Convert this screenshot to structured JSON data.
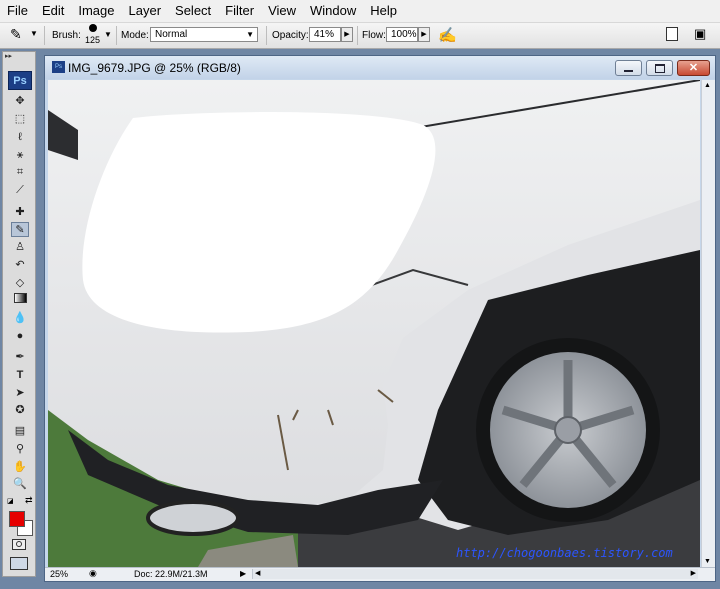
{
  "menu": [
    "File",
    "Edit",
    "Image",
    "Layer",
    "Select",
    "Filter",
    "View",
    "Window",
    "Help"
  ],
  "options": {
    "brush_label": "Brush:",
    "brush_size": "125",
    "mode_label": "Mode:",
    "mode_value": "Normal",
    "opacity_label": "Opacity:",
    "opacity_value": "41%",
    "flow_label": "Flow:",
    "flow_value": "100%"
  },
  "toolbox": {
    "logo": "Ps",
    "tools": [
      "move-tool",
      "marquee-tool",
      "lasso-tool",
      "magic-wand-tool",
      "crop-tool",
      "slice-tool",
      "healing-brush-tool",
      "brush-tool",
      "clone-stamp-tool",
      "history-brush-tool",
      "eraser-tool",
      "gradient-tool",
      "blur-tool",
      "dodge-tool",
      "pen-tool",
      "type-tool",
      "path-selection-tool",
      "shape-tool",
      "notes-tool",
      "eyedropper-tool",
      "hand-tool",
      "zoom-tool"
    ],
    "foreground_color": "#e60000",
    "background_color": "#ffffff"
  },
  "document": {
    "title": "IMG_9679.JPG @ 25% (RGB/8)",
    "watermark": "http://chogoonbaes.tistory.com",
    "zoom": "25%",
    "doc_size": "Doc: 22.9M/21.3M"
  }
}
